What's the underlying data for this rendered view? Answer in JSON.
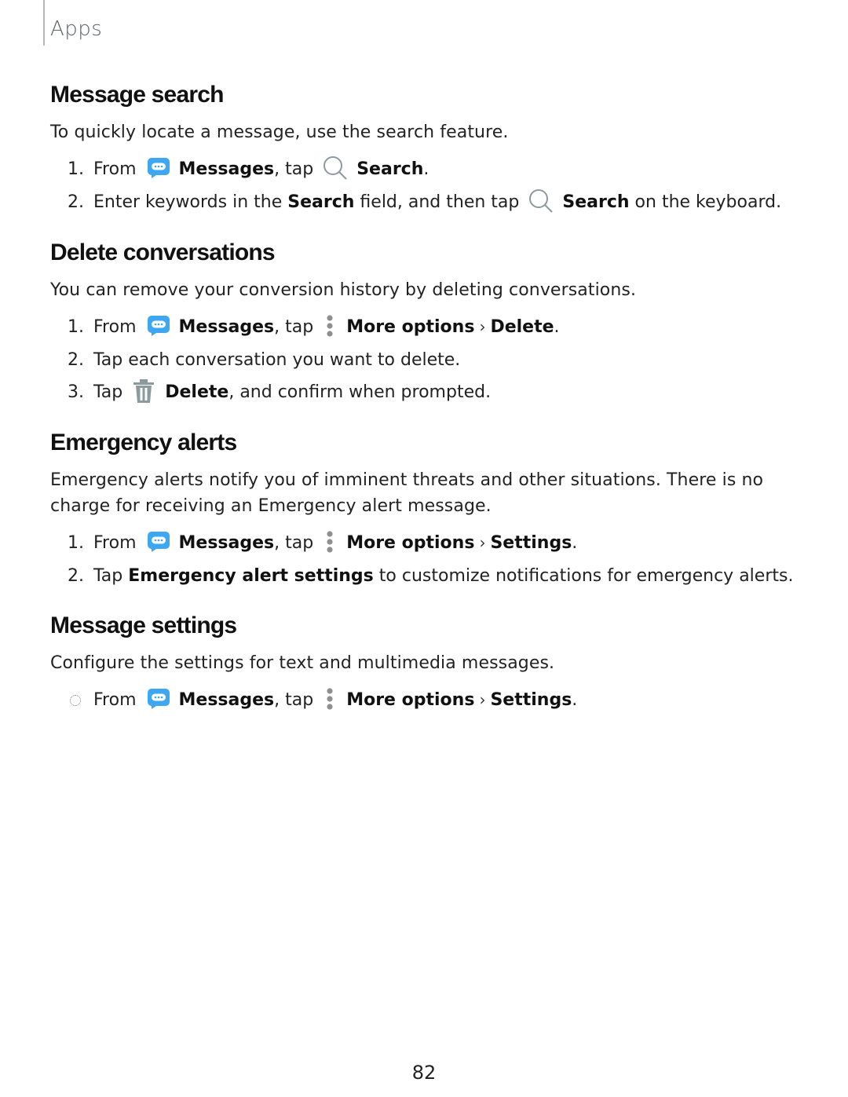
{
  "header": {
    "label": "Apps"
  },
  "sections": [
    {
      "title": "Message search",
      "intro": "To quickly locate a message, use the search feature.",
      "steps": [
        {
          "num": "1.",
          "from": "From",
          "app": "Messages",
          "tap": ", tap",
          "target": "Search",
          "end": "."
        },
        {
          "num": "2.",
          "pre": "Enter keywords in the",
          "field": "Search",
          "mid": "field, and then tap",
          "target": "Search",
          "end": "on the keyboard."
        }
      ]
    },
    {
      "title": "Delete conversations",
      "intro": "You can remove your conversion history by deleting conversations.",
      "steps": [
        {
          "num": "1.",
          "from": "From",
          "app": "Messages",
          "tap": ", tap",
          "menu": "More options",
          "target": "Delete",
          "end": "."
        },
        {
          "num": "2.",
          "text": "Tap each conversation you want to delete."
        },
        {
          "num": "3.",
          "pre": "Tap",
          "target": "Delete",
          "end": ", and confirm when prompted."
        }
      ]
    },
    {
      "title": "Emergency alerts",
      "intro": "Emergency alerts notify you of imminent threats and other situations. There is no charge for receiving an Emergency alert message.",
      "steps": [
        {
          "num": "1.",
          "from": "From",
          "app": "Messages",
          "tap": ", tap",
          "menu": "More options",
          "target": "Settings",
          "end": "."
        },
        {
          "num": "2.",
          "pre": "Tap",
          "target": "Emergency alert settings",
          "end": "to customize notifications for emergency alerts."
        }
      ]
    },
    {
      "title": "Message settings",
      "intro": "Configure the settings for text and multimedia messages.",
      "steps": [
        {
          "from": "From",
          "app": "Messages",
          "tap": ", tap",
          "menu": "More options",
          "target": "Settings",
          "end": "."
        }
      ]
    }
  ],
  "icons": {
    "messages": "messages-app-icon",
    "search": "search-icon",
    "more": "more-options-icon",
    "delete": "trash-icon",
    "separator": "›"
  },
  "colors": {
    "messages_icon": "#3ea7f2",
    "icon_gray": "#8a9a9e"
  },
  "footer": {
    "page_number": "82"
  }
}
